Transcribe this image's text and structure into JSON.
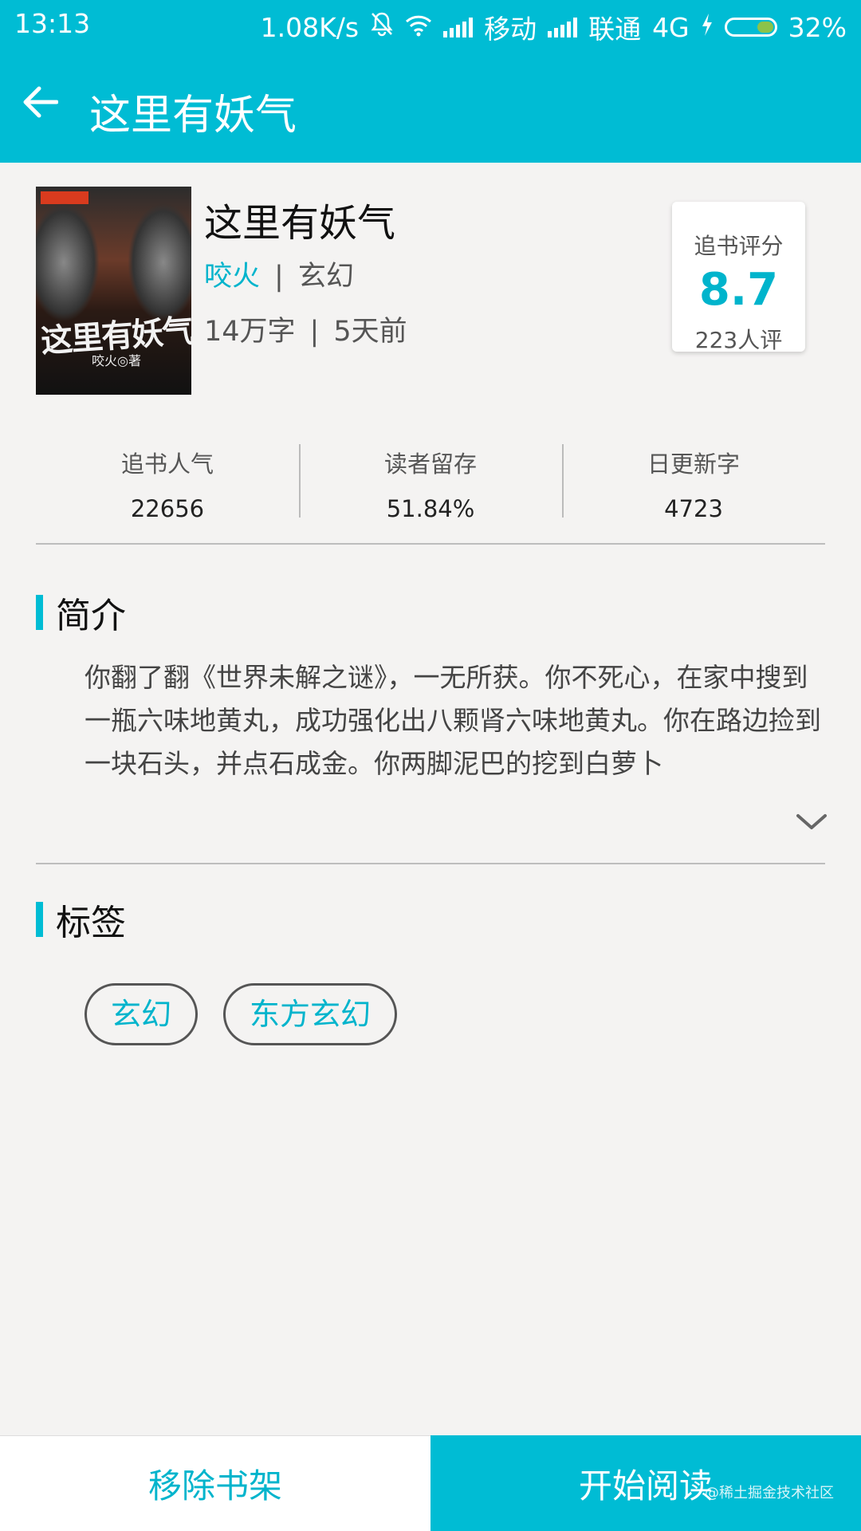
{
  "status_bar": {
    "time": "13:13",
    "speed": "1.08K/s",
    "carrier1": "移动",
    "carrier2": "联通",
    "network": "4G",
    "battery": "32%"
  },
  "app_bar": {
    "title": "这里有妖气",
    "back_icon": "arrow-left-icon"
  },
  "book": {
    "cover_title": "这里有妖气",
    "cover_author": "咬火◎著",
    "title": "这里有妖气",
    "author": "咬火",
    "genre": "玄幻",
    "words": "14万字",
    "updated": "5天前"
  },
  "rating": {
    "label": "追书评分",
    "score": "8.7",
    "count": "223人评"
  },
  "stats": [
    {
      "label": "追书人气",
      "value": "22656"
    },
    {
      "label": "读者留存",
      "value": "51.84%"
    },
    {
      "label": "日更新字",
      "value": "4723"
    }
  ],
  "intro": {
    "heading": "简介",
    "text": "你翻了翻《世界未解之谜》，一无所获。你不死心，在家中搜到一瓶六味地黄丸，成功强化出八颗肾六味地黄丸。你在路边捡到一块石头，并点石成金。你两脚泥巴的挖到白萝卜"
  },
  "tags": {
    "heading": "标签",
    "items": [
      "玄幻",
      "东方玄幻"
    ]
  },
  "actions": {
    "remove": "移除书架",
    "read": "开始阅读"
  },
  "watermark": "@稀土掘金技术社区",
  "colors": {
    "accent": "#00bcd4",
    "accent_text": "#00b4cc",
    "background": "#f4f3f2"
  }
}
